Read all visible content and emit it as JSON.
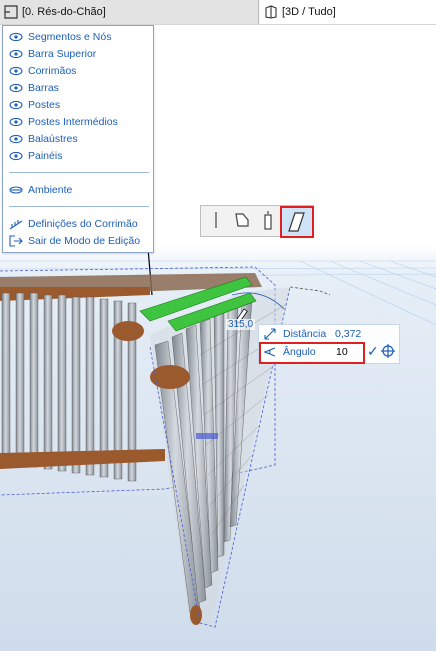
{
  "tabs": {
    "floor_plan": {
      "label": "[0. Rés-do-Chão]",
      "icon": "floor-plan-icon"
    },
    "view_3d": {
      "label": "[3D / Tudo]",
      "icon": "3d-window-icon"
    }
  },
  "palette": {
    "items": [
      {
        "label": "Segmentos e Nós",
        "icon": "eye-icon"
      },
      {
        "label": "Barra Superior",
        "icon": "eye-icon"
      },
      {
        "label": "Corrimãos",
        "icon": "eye-icon"
      },
      {
        "label": "Barras",
        "icon": "eye-icon"
      },
      {
        "label": "Postes",
        "icon": "eye-icon"
      },
      {
        "label": "Postes Intermédios",
        "icon": "eye-icon"
      },
      {
        "label": "Balaústres",
        "icon": "eye-icon"
      },
      {
        "label": "Painéis",
        "icon": "eye-icon"
      }
    ],
    "ambient": {
      "label": "Ambiente",
      "icon": "eye-closed-icon"
    },
    "settings": {
      "label": "Definições do Corrimão",
      "icon": "railing-settings-icon"
    },
    "exit": {
      "label": "Sair de Modo de Edição",
      "icon": "exit-edit-mode-icon"
    }
  },
  "toolbar": {
    "buttons": [
      {
        "name": "straight-segment-icon",
        "active": false
      },
      {
        "name": "polygon-segment-icon",
        "active": false
      },
      {
        "name": "vertical-segment-icon",
        "active": false
      },
      {
        "name": "angled-segment-icon",
        "active": true
      }
    ]
  },
  "tracker": {
    "distance": {
      "label": "Distância",
      "value": "0,372",
      "icon": "distance-icon"
    },
    "angle": {
      "label": "Ângulo",
      "value": "10",
      "icon": "angle-icon"
    },
    "confirm_icon": "checkmark-icon",
    "target_icon": "crosshair-icon"
  },
  "viewport": {
    "dimension_label": "315,0",
    "colors": {
      "sky_top": "#ffffff",
      "ground": "#d7e3ef",
      "grid": "#a8c8ea",
      "post": "#a9b0b8",
      "rail_brown": "#9a5a2e",
      "highlight_green": "#3ec43e",
      "selection_blue": "#4b5bd6",
      "accent_red": "#e02020"
    }
  }
}
